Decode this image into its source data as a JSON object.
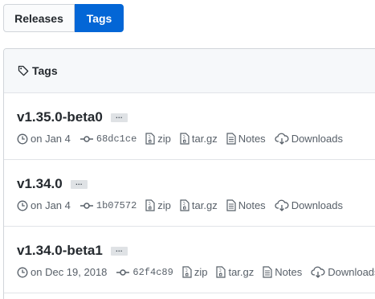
{
  "subnav": {
    "releases_label": "Releases",
    "tags_label": "Tags"
  },
  "box": {
    "header_label": "Tags"
  },
  "tags": [
    {
      "name": "v1.35.0-beta0",
      "ellipsis": "…",
      "date": "on Jan 4",
      "sha": "68dc1ce",
      "zip": "zip",
      "targz": "tar.gz",
      "notes": "Notes",
      "downloads": "Downloads"
    },
    {
      "name": "v1.34.0",
      "ellipsis": "…",
      "date": "on Jan 4",
      "sha": "1b07572",
      "zip": "zip",
      "targz": "tar.gz",
      "notes": "Notes",
      "downloads": "Downloads"
    },
    {
      "name": "v1.34.0-beta1",
      "ellipsis": "…",
      "date": "on Dec 19, 2018",
      "sha": "62f4c89",
      "zip": "zip",
      "targz": "tar.gz",
      "notes": "Notes",
      "downloads": "Downloads"
    }
  ],
  "icons": {
    "tag": "tag-icon",
    "clock": "clock-icon",
    "commit": "commit-icon",
    "zip": "file-zip-icon",
    "notes": "file-text-icon",
    "download": "cloud-download-icon"
  },
  "colors": {
    "accent": "#0366d6",
    "text": "#24292e",
    "muted": "#586069",
    "border": "#d1d5da"
  }
}
